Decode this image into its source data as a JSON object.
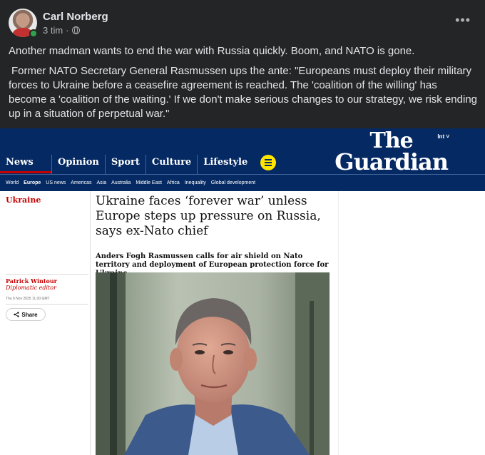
{
  "post": {
    "author": "Carl Norberg",
    "time": "3 tim",
    "separator": "·",
    "privacy_icon": "globe-icon",
    "more_label": "•••",
    "text_1": "Another madman wants to end the war with Russia quickly. Boom, and NATO is gone.",
    "text_2": "Former NATO Secretary General Rasmussen ups the ante: \"Europeans must deploy their military forces to Ukraine before a ceasefire agreement is reached. The 'coalition of the willing' has become a 'coalition of the waiting.' If we don't make serious changes to our strategy, we risk ending up in a situation of perpetual war.\""
  },
  "guardian": {
    "nav": [
      "News",
      "Opinion",
      "Sport",
      "Culture",
      "Lifestyle"
    ],
    "logo_line1": "The",
    "logo_line2": "Guardian",
    "edition": "Int ˅",
    "subnav": [
      "World",
      "Europe",
      "US news",
      "Americas",
      "Asia",
      "Australia",
      "Middle East",
      "Africa",
      "Inequality",
      "Global development"
    ],
    "section": "Ukraine",
    "headline": "Ukraine faces ‘forever war’ unless Europe steps up pressure on Russia, says ex-Nato chief",
    "standfirst": "Anders Fogh Rasmussen calls for air shield on Nato territory and deployment of European protection force for Ukraine",
    "author": "Patrick Wintour",
    "author_role": "Diplomatic editor",
    "date": "Thu 6 Nov 2025 11.00 GMT",
    "share": "Share"
  },
  "colors": {
    "fb_bg": "#242526",
    "guardian_blue": "#052962",
    "guardian_red": "#c70000",
    "menu_yellow": "#ffe500"
  }
}
